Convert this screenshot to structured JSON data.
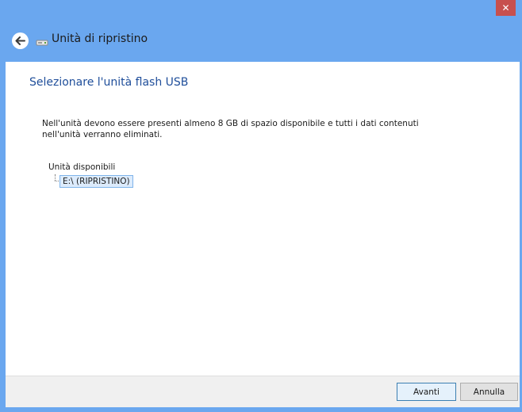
{
  "window": {
    "close_glyph": "✕"
  },
  "header": {
    "title": "Unità di ripristino",
    "back_icon": "back-arrow-icon",
    "drive_icon": "usb-drive-icon"
  },
  "content": {
    "heading": "Selezionare l'unità flash USB",
    "description_line1": "Nell'unità devono essere presenti almeno 8 GB di spazio disponibile e tutti i dati contenuti",
    "description_line2": "nell'unità verranno eliminati.",
    "available_label": "Unità disponibili",
    "drives": [
      {
        "label": "E:\\ (RIPRISTINO)",
        "selected": true
      }
    ]
  },
  "footer": {
    "next_label": "Avanti",
    "cancel_label": "Annulla"
  },
  "colors": {
    "titlebar": "#6aa7ef",
    "close": "#c7504e",
    "heading": "#1f4e9a",
    "selection": "#dcebfc"
  }
}
